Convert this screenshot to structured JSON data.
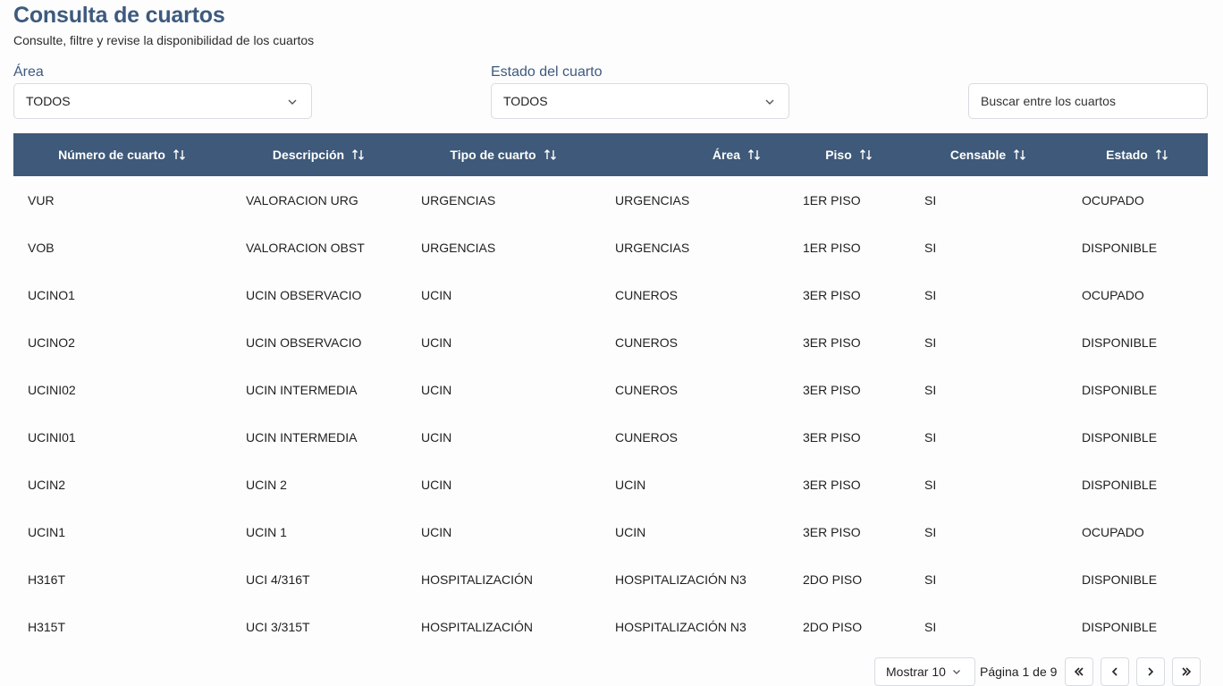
{
  "header": {
    "title": "Consulta de cuartos",
    "subtitle": "Consulte, filtre y revise la disponibilidad de los cuartos"
  },
  "filters": {
    "area_label": "Área",
    "area_value": "TODOS",
    "estado_label": "Estado del cuarto",
    "estado_value": "TODOS",
    "search_placeholder": "Buscar entre los cuartos"
  },
  "table": {
    "columns": [
      "Número de cuarto",
      "Descripción",
      "Tipo de cuarto",
      "Área",
      "Piso",
      "Censable",
      "Estado"
    ],
    "rows": [
      [
        "VUR",
        "VALORACION URG",
        "URGENCIAS",
        "URGENCIAS",
        "1ER PISO",
        "SI",
        "OCUPADO"
      ],
      [
        "VOB",
        "VALORACION OBST",
        "URGENCIAS",
        "URGENCIAS",
        "1ER PISO",
        "SI",
        "DISPONIBLE"
      ],
      [
        "UCINO1",
        "UCIN OBSERVACIO",
        "UCIN",
        "CUNEROS",
        "3ER PISO",
        "SI",
        "OCUPADO"
      ],
      [
        "UCINO2",
        "UCIN OBSERVACIO",
        "UCIN",
        "CUNEROS",
        "3ER PISO",
        "SI",
        "DISPONIBLE"
      ],
      [
        "UCINI02",
        "UCIN INTERMEDIA",
        "UCIN",
        "CUNEROS",
        "3ER PISO",
        "SI",
        "DISPONIBLE"
      ],
      [
        "UCINI01",
        "UCIN INTERMEDIA",
        "UCIN",
        "CUNEROS",
        "3ER PISO",
        "SI",
        "DISPONIBLE"
      ],
      [
        "UCIN2",
        "UCIN 2",
        "UCIN",
        "UCIN",
        "3ER PISO",
        "SI",
        "DISPONIBLE"
      ],
      [
        "UCIN1",
        "UCIN 1",
        "UCIN",
        "UCIN",
        "3ER PISO",
        "SI",
        "OCUPADO"
      ],
      [
        "H316T",
        "UCI 4/316T",
        "HOSPITALIZACIÓN",
        "HOSPITALIZACIÓN N3",
        "2DO PISO",
        "SI",
        "DISPONIBLE"
      ],
      [
        "H315T",
        "UCI 3/315T",
        "HOSPITALIZACIÓN",
        "HOSPITALIZACIÓN N3",
        "2DO PISO",
        "SI",
        "DISPONIBLE"
      ]
    ]
  },
  "pagination": {
    "page_size_label": "Mostrar 10",
    "page_info": "Página 1 de 9"
  },
  "icons": {
    "sort": "sort-icon",
    "dropdown": "chevron-down-icon",
    "first": "chevrons-left-icon",
    "prev": "chevron-left-icon",
    "next": "chevron-right-icon",
    "last": "chevrons-right-icon"
  },
  "colors": {
    "title": "#3d5a7e",
    "table_header": "#3e5979"
  }
}
